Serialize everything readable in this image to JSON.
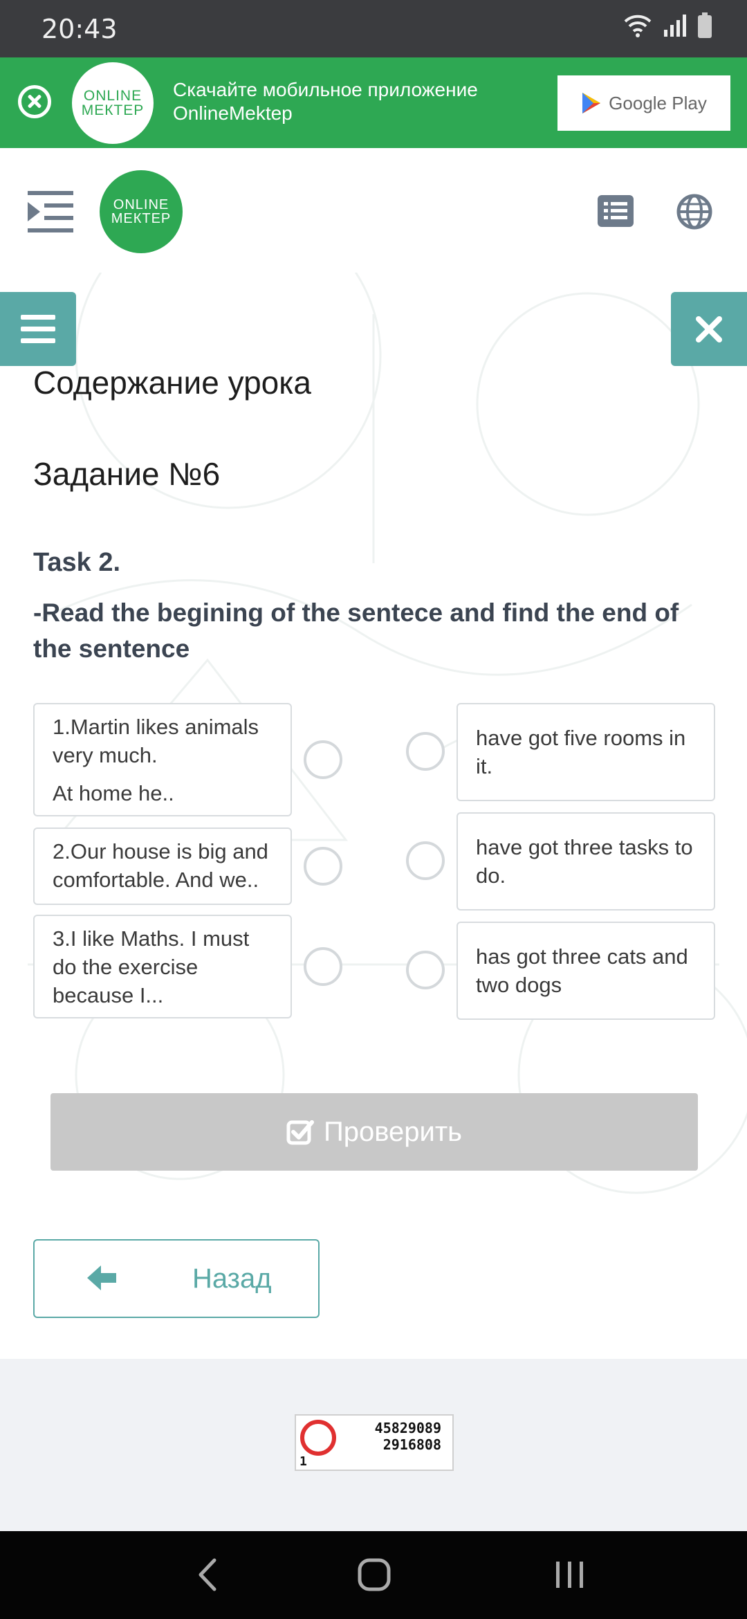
{
  "status_bar": {
    "time": "20:43"
  },
  "banner": {
    "logo_line1": "ONLINE",
    "logo_line2": "МЕКТЕР",
    "text": "Скачайте мобильное приложение OnlineMektep",
    "store_label": "Google Play"
  },
  "header": {
    "logo_line1": "ONLINE",
    "logo_line2": "МЕКТЕР"
  },
  "lesson": {
    "title": "Содержание урока",
    "task_title": "Задание №6",
    "task_label": "Task 2.",
    "instruction": "-Read the begining of the sentece and find the end of the sentence"
  },
  "match": {
    "left": [
      {
        "line1": "1.Martin likes animals very much.",
        "line2": "At home he.."
      },
      {
        "line1": "2.Our house is big and comfortable. And we..",
        "line2": ""
      },
      {
        "line1": "3.I like Maths. I must do the exercise because I...",
        "line2": ""
      }
    ],
    "right": [
      {
        "text": "have got five rooms in it."
      },
      {
        "text": "have got three tasks to do."
      },
      {
        "text": "has got three cats and two dogs"
      }
    ]
  },
  "buttons": {
    "check_label": "Проверить",
    "back_label": "Назад"
  },
  "counter": {
    "line1": "45829089",
    "line2": "2916808",
    "rank": "1"
  },
  "colors": {
    "brand_green": "#2ea853",
    "accent_teal": "#5aa9a6",
    "disabled_gray": "#c8c8c8"
  }
}
